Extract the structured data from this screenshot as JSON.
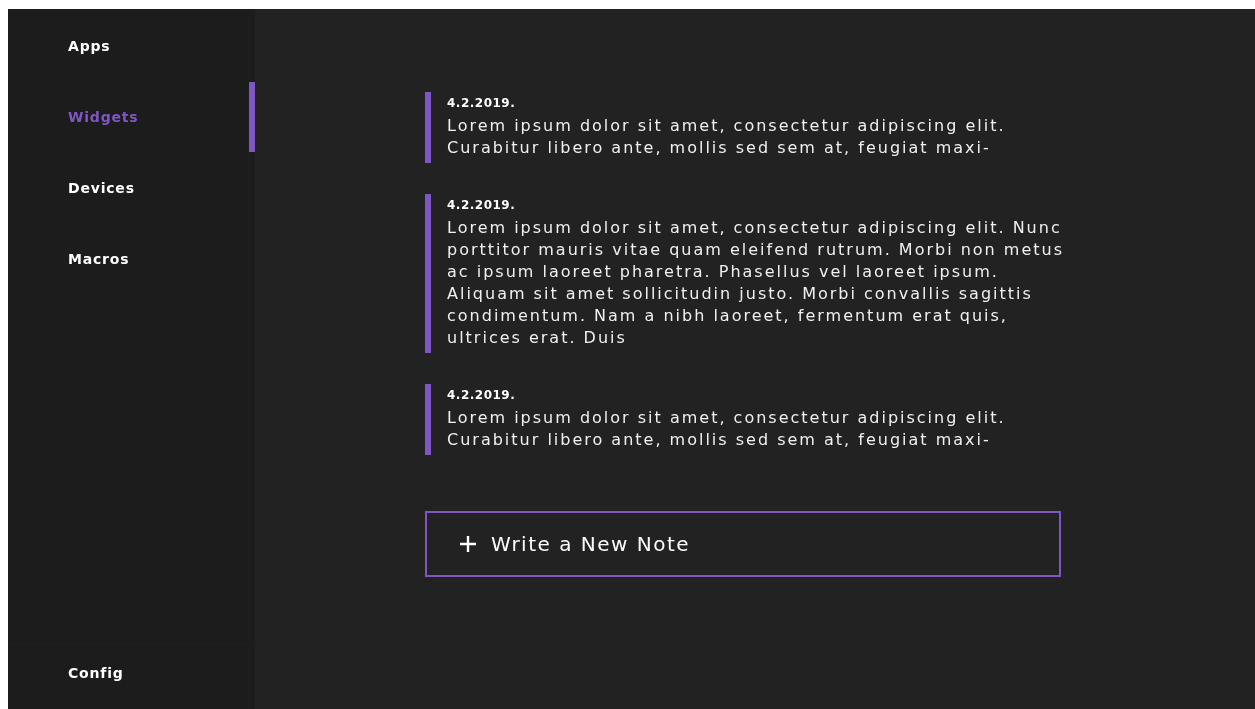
{
  "sidebar": {
    "items": [
      {
        "label": "Apps",
        "selected": false
      },
      {
        "label": "Widgets",
        "selected": true
      },
      {
        "label": "Devices",
        "selected": false
      },
      {
        "label": "Macros",
        "selected": false
      }
    ],
    "footer_item": {
      "label": "Config"
    }
  },
  "notes": [
    {
      "date": "4.2.2019.",
      "text": "Lorem ipsum dolor sit amet, consectetur adipiscing elit. Curabitur libero ante, mollis sed sem at, feugiat maxi-"
    },
    {
      "date": "4.2.2019.",
      "text": "Lorem ipsum dolor sit amet, consectetur adipiscing elit. Nunc porttitor mauris vitae quam eleifend rutrum. Morbi non metus ac ipsum laoreet pharetra. Phasellus vel laoreet ipsum. Aliquam sit amet sollicitudin justo. Morbi convallis sagittis condimentum. Nam a nibh laoreet, fermentum erat quis, ultrices erat. Duis"
    },
    {
      "date": "4.2.2019.",
      "text": "Lorem ipsum dolor sit amet, consectetur adipiscing elit. Curabitur libero ante, mollis sed sem at, feugiat maxi-"
    }
  ],
  "new_note_button": {
    "label": "Write a New Note"
  }
}
